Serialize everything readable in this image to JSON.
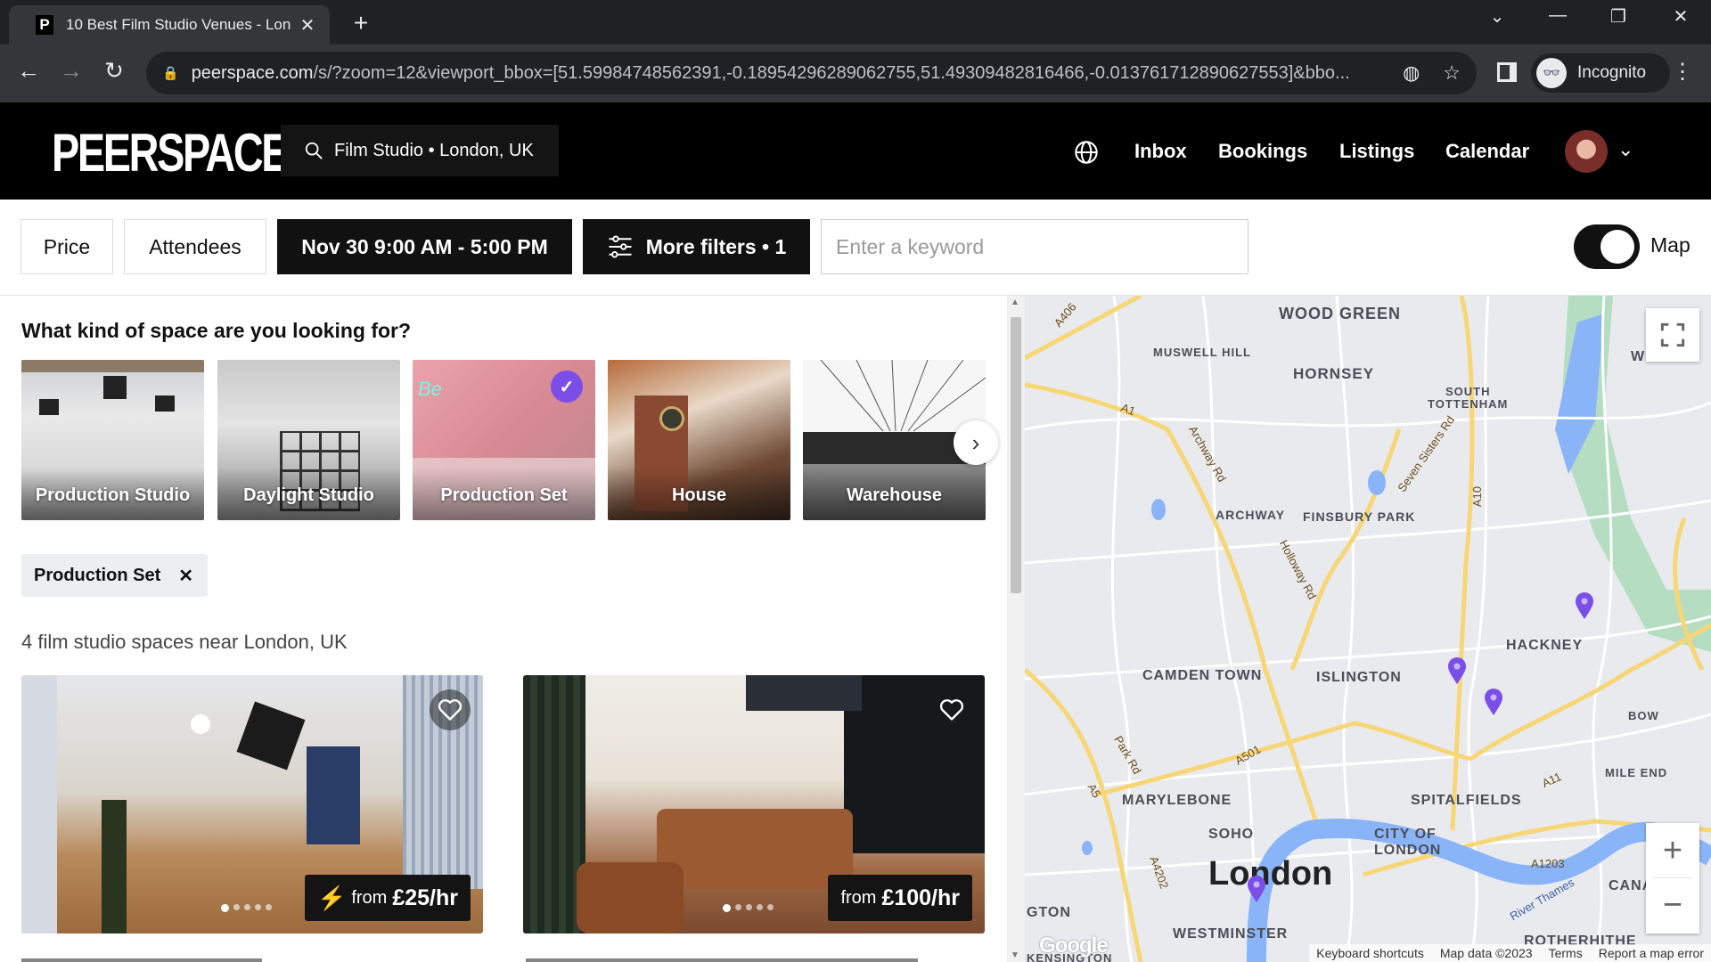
{
  "browser": {
    "tab_title": "10 Best Film Studio Venues - Lon",
    "favicon_letter": "P",
    "url_host": "peerspace.com",
    "url_path": "/s/?zoom=12&viewport_bbox=[51.59984748562391,-0.18954296289062755,51.49309482816466,-0.013761712890627553]&bbo...",
    "profile_label": "Incognito"
  },
  "header": {
    "logo": "PEERSPACE",
    "search_text": "Film Studio • London, UK",
    "nav": [
      {
        "label": "Inbox"
      },
      {
        "label": "Bookings"
      },
      {
        "label": "Listings"
      },
      {
        "label": "Calendar"
      }
    ]
  },
  "filters": {
    "price": "Price",
    "attendees": "Attendees",
    "date": "Nov 30 9:00 AM - 5:00 PM",
    "more_filters": "More filters • 1",
    "keyword_placeholder": "Enter a keyword",
    "map_toggle_label": "Map",
    "map_toggle_on": true
  },
  "categories": {
    "question": "What kind of space are you looking for?",
    "items": [
      {
        "label": "Production Studio",
        "selected": false
      },
      {
        "label": "Daylight Studio",
        "selected": false
      },
      {
        "label": "Production Set",
        "selected": true
      },
      {
        "label": "House",
        "selected": false
      },
      {
        "label": "Warehouse",
        "selected": false
      }
    ]
  },
  "active_chip": "Production Set",
  "results_count": "4 film studio spaces near London, UK",
  "listings": [
    {
      "price_prefix": "from",
      "price": "£25/hr",
      "instant_book": true,
      "photo_count": 5
    },
    {
      "price_prefix": "from",
      "price": "£100/hr",
      "instant_book": false,
      "photo_count": 5
    }
  ],
  "map": {
    "areas": [
      "WOOD GREEN",
      "MUSWELL HILL",
      "HORNSEY",
      "SOUTH",
      "TOTTENHAM",
      "ARCHWAY",
      "FINSBURY PARK",
      "CAMDEN TOWN",
      "ISLINGTON",
      "HACKNEY",
      "BOW",
      "MILE END",
      "MARYLEBONE",
      "SPITALFIELDS",
      "SOHO",
      "CITY OF",
      "LONDON",
      "London",
      "WESTMINSTER",
      "CANA",
      "ROTHERHITHE",
      "KENSINGTON",
      "GTON",
      "W"
    ],
    "roads": [
      "A406",
      "A1",
      "Archway Rd",
      "Seven Sisters Rd",
      "A10",
      "Holloway Rd",
      "Park Rd",
      "A501",
      "A5",
      "A4202",
      "A1203",
      "A11",
      "River Thames"
    ],
    "footer": [
      "Keyboard shortcuts",
      "Map data ©2023",
      "Terms",
      "Report a map error"
    ],
    "google": "Google",
    "pin_color": "#7b4ee8"
  }
}
